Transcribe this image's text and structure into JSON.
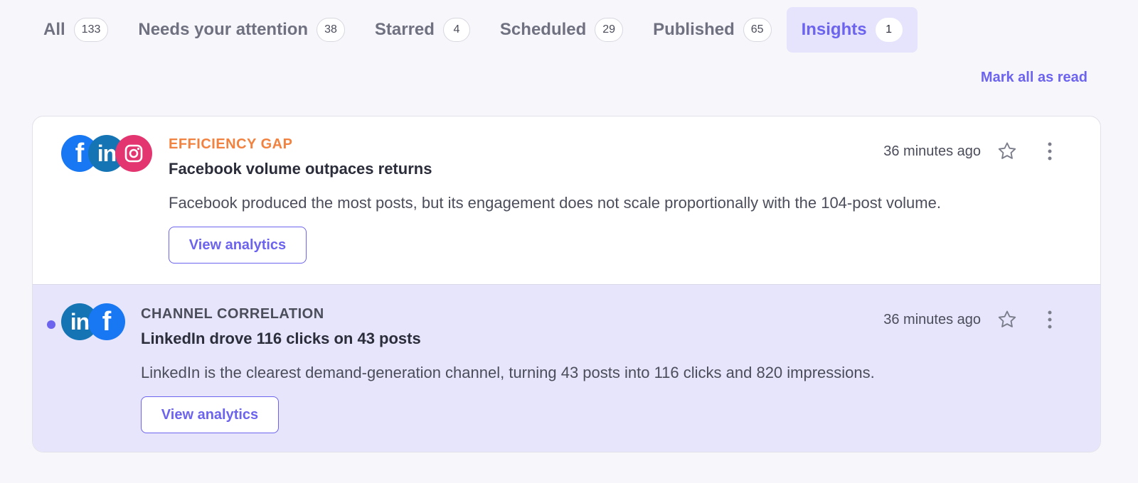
{
  "tabs": [
    {
      "label": "All",
      "count": "133"
    },
    {
      "label": "Needs your attention",
      "count": "38"
    },
    {
      "label": "Starred",
      "count": "4"
    },
    {
      "label": "Scheduled",
      "count": "29"
    },
    {
      "label": "Published",
      "count": "65"
    },
    {
      "label": "Insights",
      "count": "1",
      "active": true
    }
  ],
  "mark_all_read": "Mark all as read",
  "cards": [
    {
      "category": "EFFICIENCY GAP",
      "headline": "Facebook volume outpaces returns",
      "body": "Facebook produced the most posts, but its engagement does not scale proportionally with the 104-post volume.",
      "time": "36 minutes ago",
      "button": "View analytics",
      "channels": [
        "facebook-icon",
        "linkedin-icon",
        "instagram-icon"
      ],
      "unread": false
    },
    {
      "category": "CHANNEL CORRELATION",
      "headline": "LinkedIn drove 116 clicks on 43 posts",
      "body": "LinkedIn is the clearest demand-generation channel, turning 43 posts into 116 clicks and 820 impressions.",
      "time": "36 minutes ago",
      "button": "View analytics",
      "channels": [
        "linkedin-icon",
        "facebook-icon"
      ],
      "unread": true
    }
  ],
  "colors": {
    "accent": "#6c63ee",
    "category_orange": "#f1823f",
    "unread_bg": "#e6e5fc",
    "facebook": "#1877f2",
    "linkedin": "#1474b4",
    "instagram": "#e33670"
  }
}
